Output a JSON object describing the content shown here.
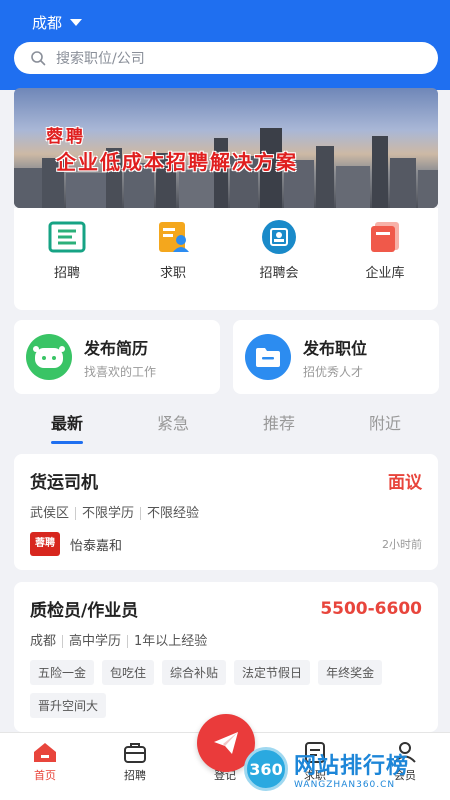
{
  "header": {
    "city": "成都",
    "search_placeholder": "搜索职位/公司"
  },
  "banner": {
    "line1": "蓉聘",
    "line2": "企业低成本招聘解决方案"
  },
  "quick_links": [
    {
      "label": "招聘",
      "icon": "recruit-icon"
    },
    {
      "label": "求职",
      "icon": "job-seek-icon"
    },
    {
      "label": "招聘会",
      "icon": "job-fair-icon"
    },
    {
      "label": "企业库",
      "icon": "company-library-icon"
    }
  ],
  "publish": [
    {
      "title": "发布简历",
      "subtitle": "找喜欢的工作",
      "color": "#39c465"
    },
    {
      "title": "发布职位",
      "subtitle": "招优秀人才",
      "color": "#2c8cf0"
    }
  ],
  "tabs": [
    {
      "label": "最新",
      "active": true
    },
    {
      "label": "紧急",
      "active": false
    },
    {
      "label": "推荐",
      "active": false
    },
    {
      "label": "附近",
      "active": false
    }
  ],
  "jobs": [
    {
      "title": "货运司机",
      "salary": "面议",
      "meta": [
        "武侯区",
        "不限学历",
        "不限经验"
      ],
      "company": "怡泰嘉和",
      "logo_text": "蓉聘",
      "time": "2小时前"
    },
    {
      "title": "质检员/作业员",
      "salary": "5500-6600",
      "meta": [
        "成都",
        "高中学历",
        "1年以上经验"
      ],
      "tags": [
        "五险一金",
        "包吃住",
        "综合补贴",
        "法定节假日",
        "年终奖金",
        "晋升空间大"
      ]
    }
  ],
  "bottom_nav": [
    {
      "label": "首页",
      "icon": "home-icon",
      "active": true
    },
    {
      "label": "招聘",
      "icon": "briefcase-icon",
      "active": false
    },
    {
      "label": "登记",
      "icon": "send-icon",
      "active": false
    },
    {
      "label": "求职",
      "icon": "resume-icon",
      "active": false
    },
    {
      "label": "会员",
      "icon": "user-icon",
      "active": false
    }
  ],
  "watermark": {
    "logo": "360",
    "text": "网站排行榜",
    "url": "WANGZHAN360.CN"
  },
  "colors": {
    "primary": "#1f6ff0",
    "accent": "#e8453c",
    "green": "#39c465"
  }
}
